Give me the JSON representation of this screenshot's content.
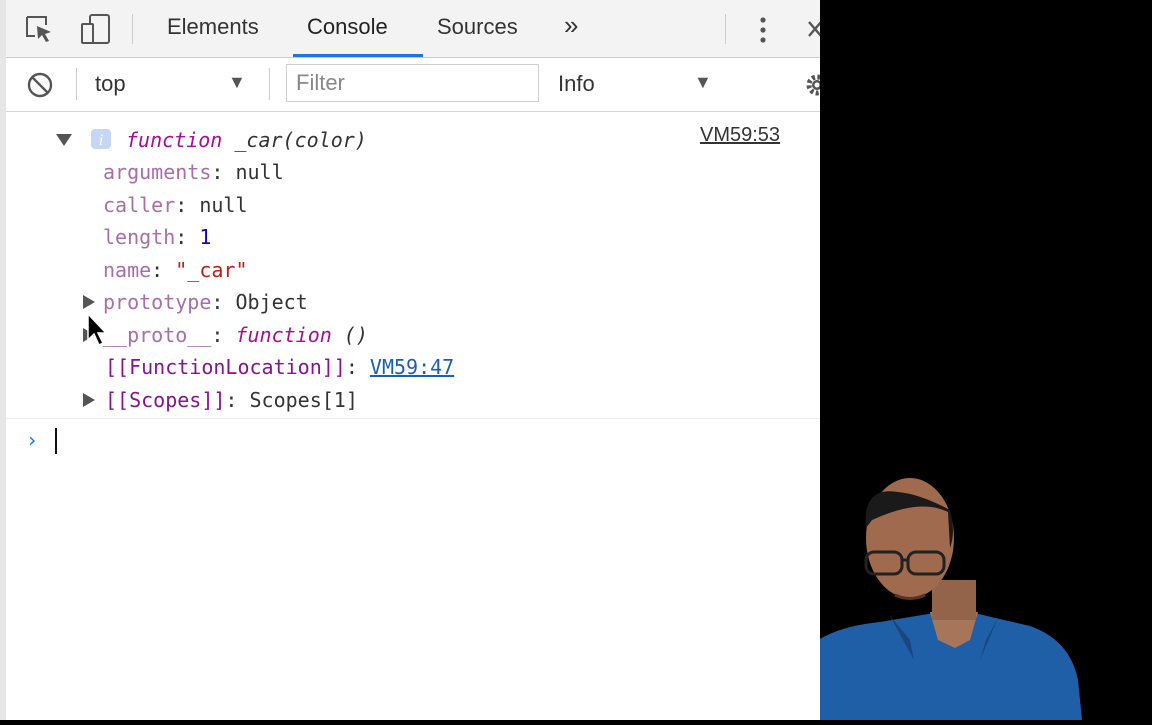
{
  "tabs": {
    "elements": "Elements",
    "console": "Console",
    "sources": "Sources",
    "more": "»"
  },
  "toolbar": {
    "context": "top",
    "filter_placeholder": "Filter",
    "level": "Info"
  },
  "log": {
    "source_link": "VM59:53",
    "header_keyword": "function",
    "header_sig": "_car(color)",
    "rows": [
      {
        "key": "arguments",
        "value": "null"
      },
      {
        "key": "caller",
        "value": "null"
      },
      {
        "key": "length",
        "value": "1"
      },
      {
        "key": "name",
        "value": "\"_car\""
      },
      {
        "key": "prototype",
        "value": "Object"
      },
      {
        "key": "__proto__",
        "value_keyword": "function",
        "value": "()"
      },
      {
        "key": "[[FunctionLocation]]",
        "value": "VM59:47"
      },
      {
        "key": "[[Scopes]]",
        "value": "Scopes[1]"
      }
    ]
  },
  "prompt": {
    "symbol": "›"
  },
  "colors": {
    "accent": "#1a73e8",
    "keyword": "#aa0d91",
    "property": "#881391",
    "number": "#1c00cf",
    "string": "#c41a16"
  },
  "icons": [
    "inspect-element-icon",
    "device-toolbar-icon",
    "more-vert-icon",
    "close-icon",
    "clear-console-icon",
    "settings-gear-icon",
    "info-icon",
    "mouse-pointer-icon"
  ]
}
